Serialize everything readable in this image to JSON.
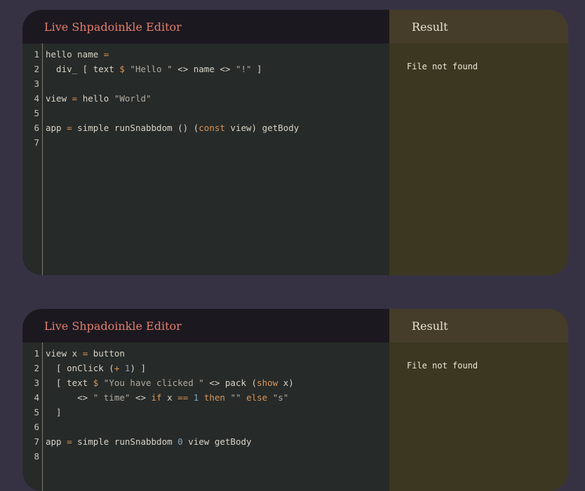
{
  "editors": [
    {
      "title": "Live Shpadoinkle Editor",
      "result_title": "Result",
      "result_text": "File not found",
      "line_numbers": [
        "1",
        "2",
        "3",
        "4",
        "5",
        "6",
        "7"
      ],
      "lines": [
        [
          [
            "hello name ",
            "p"
          ],
          [
            "=",
            "o"
          ]
        ],
        [
          [
            "  div_ [ text ",
            "p"
          ],
          [
            "$",
            "o"
          ],
          [
            " ",
            "p"
          ],
          [
            "\"Hello \"",
            "s"
          ],
          [
            " <> name <> ",
            "p"
          ],
          [
            "\"!\"",
            "s"
          ],
          [
            " ]",
            "p"
          ]
        ],
        [],
        [
          [
            "view ",
            "p"
          ],
          [
            "=",
            "o"
          ],
          [
            " hello ",
            "p"
          ],
          [
            "\"World\"",
            "s"
          ]
        ],
        [],
        [
          [
            "app ",
            "p"
          ],
          [
            "=",
            "o"
          ],
          [
            " simple runSnabbdom () (",
            "p"
          ],
          [
            "const",
            "k"
          ],
          [
            " view) getBody",
            "p"
          ]
        ],
        []
      ]
    },
    {
      "title": "Live Shpadoinkle Editor",
      "result_title": "Result",
      "result_text": "File not found",
      "line_numbers": [
        "1",
        "2",
        "3",
        "4",
        "5",
        "6",
        "7",
        "8"
      ],
      "lines": [
        [
          [
            "view x ",
            "p"
          ],
          [
            "=",
            "o"
          ],
          [
            " button",
            "p"
          ]
        ],
        [
          [
            "  [ onClick (",
            "p"
          ],
          [
            "+",
            "o"
          ],
          [
            " ",
            "p"
          ],
          [
            "1",
            "n"
          ],
          [
            ") ]",
            "p"
          ]
        ],
        [
          [
            "  [ text ",
            "p"
          ],
          [
            "$",
            "o"
          ],
          [
            " ",
            "p"
          ],
          [
            "\"You have clicked \"",
            "s"
          ],
          [
            " <> pack (",
            "p"
          ],
          [
            "show",
            "k"
          ],
          [
            " x)",
            "p"
          ]
        ],
        [
          [
            "      <> ",
            "p"
          ],
          [
            "\" time\"",
            "s"
          ],
          [
            " <> ",
            "p"
          ],
          [
            "if",
            "k"
          ],
          [
            " x ",
            "p"
          ],
          [
            "==",
            "o"
          ],
          [
            " ",
            "p"
          ],
          [
            "1",
            "n"
          ],
          [
            " ",
            "p"
          ],
          [
            "then",
            "k"
          ],
          [
            " ",
            "p"
          ],
          [
            "\"\"",
            "s"
          ],
          [
            " ",
            "p"
          ],
          [
            "else",
            "k"
          ],
          [
            " ",
            "p"
          ],
          [
            "\"s\"",
            "s"
          ]
        ],
        [
          [
            "  ]",
            "p"
          ]
        ],
        [],
        [
          [
            "app ",
            "p"
          ],
          [
            "=",
            "o"
          ],
          [
            " simple runSnabbdom ",
            "p"
          ],
          [
            "0",
            "n"
          ],
          [
            " view getBody",
            "p"
          ]
        ],
        []
      ]
    }
  ]
}
